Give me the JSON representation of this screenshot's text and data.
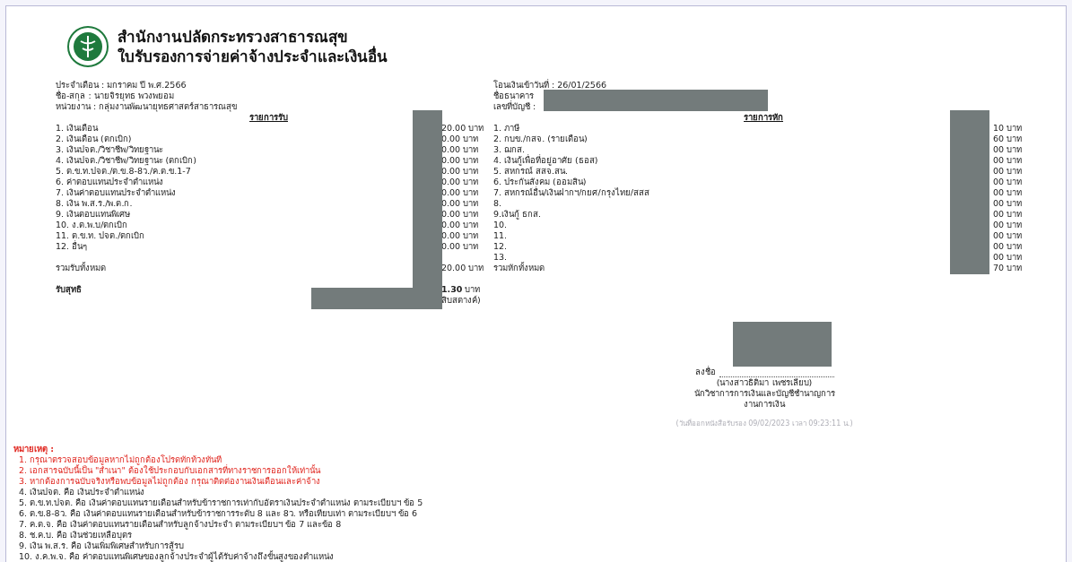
{
  "header": {
    "title": "สำนักงานปลัดกระทรวงสาธารณสุข",
    "subtitle": "ใบรับรองการจ่ายค่าจ้างประจำและเงินอื่น"
  },
  "info_left": [
    "ประจำเดือน : มกราคม ปี พ.ศ.2566",
    "ชื่อ-สกุล : นายจิรยุทธ พวงพยอม",
    "หน่วยงาน : กลุ่มงานพัฒนายุทธศาสตร์สาธารณสุข"
  ],
  "info_right": [
    "โอนเงินเข้าวันที่ : 26/01/2566",
    "ชื่อธนาคาร",
    "เลขที่บัญชี :"
  ],
  "earnings": {
    "heading": "รายการรับ",
    "items": [
      {
        "label": "1. เงินเดือน",
        "amount": "20.00 บาท"
      },
      {
        "label": "2. เงินเดือน (ตกเบิก)",
        "amount": "0.00 บาท"
      },
      {
        "label": "3. เงินปจต./วิชาชีพ/วิทยฐานะ",
        "amount": "0.00 บาท"
      },
      {
        "label": "4. เงินปจต./วิชาชีพ/วิทยฐานะ (ตกเบิก)",
        "amount": "0.00 บาท"
      },
      {
        "label": "5. ต.ข.ท.ปจต./ต.ข.8-8ว./ค.ต.ข.1-7",
        "amount": "0.00 บาท"
      },
      {
        "label": "6. ค่าตอบแทนประจำตำแหน่ง",
        "amount": "0.00 บาท"
      },
      {
        "label": "7. เงินค่าตอบแทนประจำตำแหน่ง",
        "amount": "0.00 บาท"
      },
      {
        "label": "8. เงิน พ.ส.ร./พ.ต.ก.",
        "amount": "0.00 บาท"
      },
      {
        "label": "9. เงินตอบแทนพิเศษ",
        "amount": "0.00 บาท"
      },
      {
        "label": "10. ง.ต.พ.บ/ตกเบิก",
        "amount": "0.00 บาท"
      },
      {
        "label": "11. ต.ข.ท. ปจต./ตกเบิก",
        "amount": "0.00 บาท"
      },
      {
        "label": "12. อื่นๆ",
        "amount": "0.00 บาท"
      }
    ],
    "total": {
      "label": "รวมรับทั้งหมด",
      "amount": "20.00 บาท"
    },
    "net": {
      "label": "รับสุทธิ",
      "amount": "**1.30** บาท",
      "note": "สิบสตางค์)"
    }
  },
  "deductions": {
    "heading": "รายการหัก",
    "items": [
      {
        "label": "1. ภาษี",
        "amount": "10 บาท"
      },
      {
        "label": "2. กบข./กสจ. (รายเดือน)",
        "amount": "60 บาท"
      },
      {
        "label": "3. ฌกส.",
        "amount": "00 บาท"
      },
      {
        "label": "4. เงินกู้เพื่อที่อยู่อาศัย (ธอส)",
        "amount": "00 บาท"
      },
      {
        "label": "5. สหกรณ์ สสจ.สน.",
        "amount": "00 บาท"
      },
      {
        "label": "6. ประกันสังคม (ออมสิน)",
        "amount": "00 บาท"
      },
      {
        "label": "7. สหกรณ์อื่น/เงินฝากฯ/กยศ/กรุงไทย/สสส",
        "amount": "00 บาท"
      },
      {
        "label": "8.",
        "amount": "00 บาท"
      },
      {
        "label": "9.เงินกู้ ธกส.",
        "amount": "00 บาท"
      },
      {
        "label": "10.",
        "amount": "00 บาท"
      },
      {
        "label": "11.",
        "amount": "00 บาท"
      },
      {
        "label": "12.",
        "amount": "00 บาท"
      },
      {
        "label": "13.",
        "amount": "00 บาท"
      }
    ],
    "total": {
      "label": "รวมหักทั้งหมด",
      "amount": "70 บาท"
    }
  },
  "signature": {
    "sign_label": "ลงชื่อ",
    "name": "(นางสาวธิติมา   เพชรเลียบ)",
    "position": "นักวิชาการการเงินและบัญชีชำนาญการ",
    "department": "งานการเงิน",
    "issued": "(วันที่ออกหนังสือรับรอง 09/02/2023 เวลา 09:23:11 น.)"
  },
  "notes": {
    "heading": "หมายเหตุ :",
    "items": [
      {
        "kind": "warning",
        "text": "1. กรุณาตรวจสอบข้อมูลหากไม่ถูกต้องโปรดทักท้วงทันที"
      },
      {
        "kind": "warning",
        "text": "2. เอกสารฉบับนี้เป็น \"สำเนา\" ต้องใช้ประกอบกับเอกสารที่ทางราชการออกให้เท่านั้น"
      },
      {
        "kind": "warning",
        "text": "3. หากต้องการฉบับจริงหรือพบข้อมูลไม่ถูกต้อง กรุณาติดต่องานเงินเดือนและค่าจ้าง"
      },
      {
        "kind": "info",
        "text": "4. เงินปจต. คือ เงินประจำตำแหน่ง"
      },
      {
        "kind": "info",
        "text": "5. ต.ข.ท.ปจต. คือ เงินค่าตอบแทนรายเดือนสำหรับข้าราชการเท่ากับอัตราเงินประจำตำแหน่ง ตามระเบียบฯ ข้อ 5"
      },
      {
        "kind": "info",
        "text": "6. ต.ข.8-8ว. คือ เงินค่าตอบแทนรายเดือนสำหรับข้าราชการระดับ 8 และ 8ว. หรือเทียบเท่า ตามระเบียบฯ ข้อ 6"
      },
      {
        "kind": "info",
        "text": "7. ค.ต.จ. คือ เงินค่าตอบแทนรายเดือนสำหรับลูกจ้างประจำ ตามระเบียบฯ ข้อ 7 และข้อ 8"
      },
      {
        "kind": "info",
        "text": "8. ช.ค.บ. คือ เงินช่วยเหลือบุตร"
      },
      {
        "kind": "info",
        "text": "9. เงิน พ.ส.ร. คือ เงินเพิ่มพิเศษสำหรับการสู้รบ"
      },
      {
        "kind": "info",
        "text": "10. ง.ค.พ.จ. คือ ค่าตอบแทนพิเศษของลูกจ้างประจำผู้ได้รับค่าจ้างถึงขั้นสูงของตำแหน่ง"
      }
    ]
  }
}
